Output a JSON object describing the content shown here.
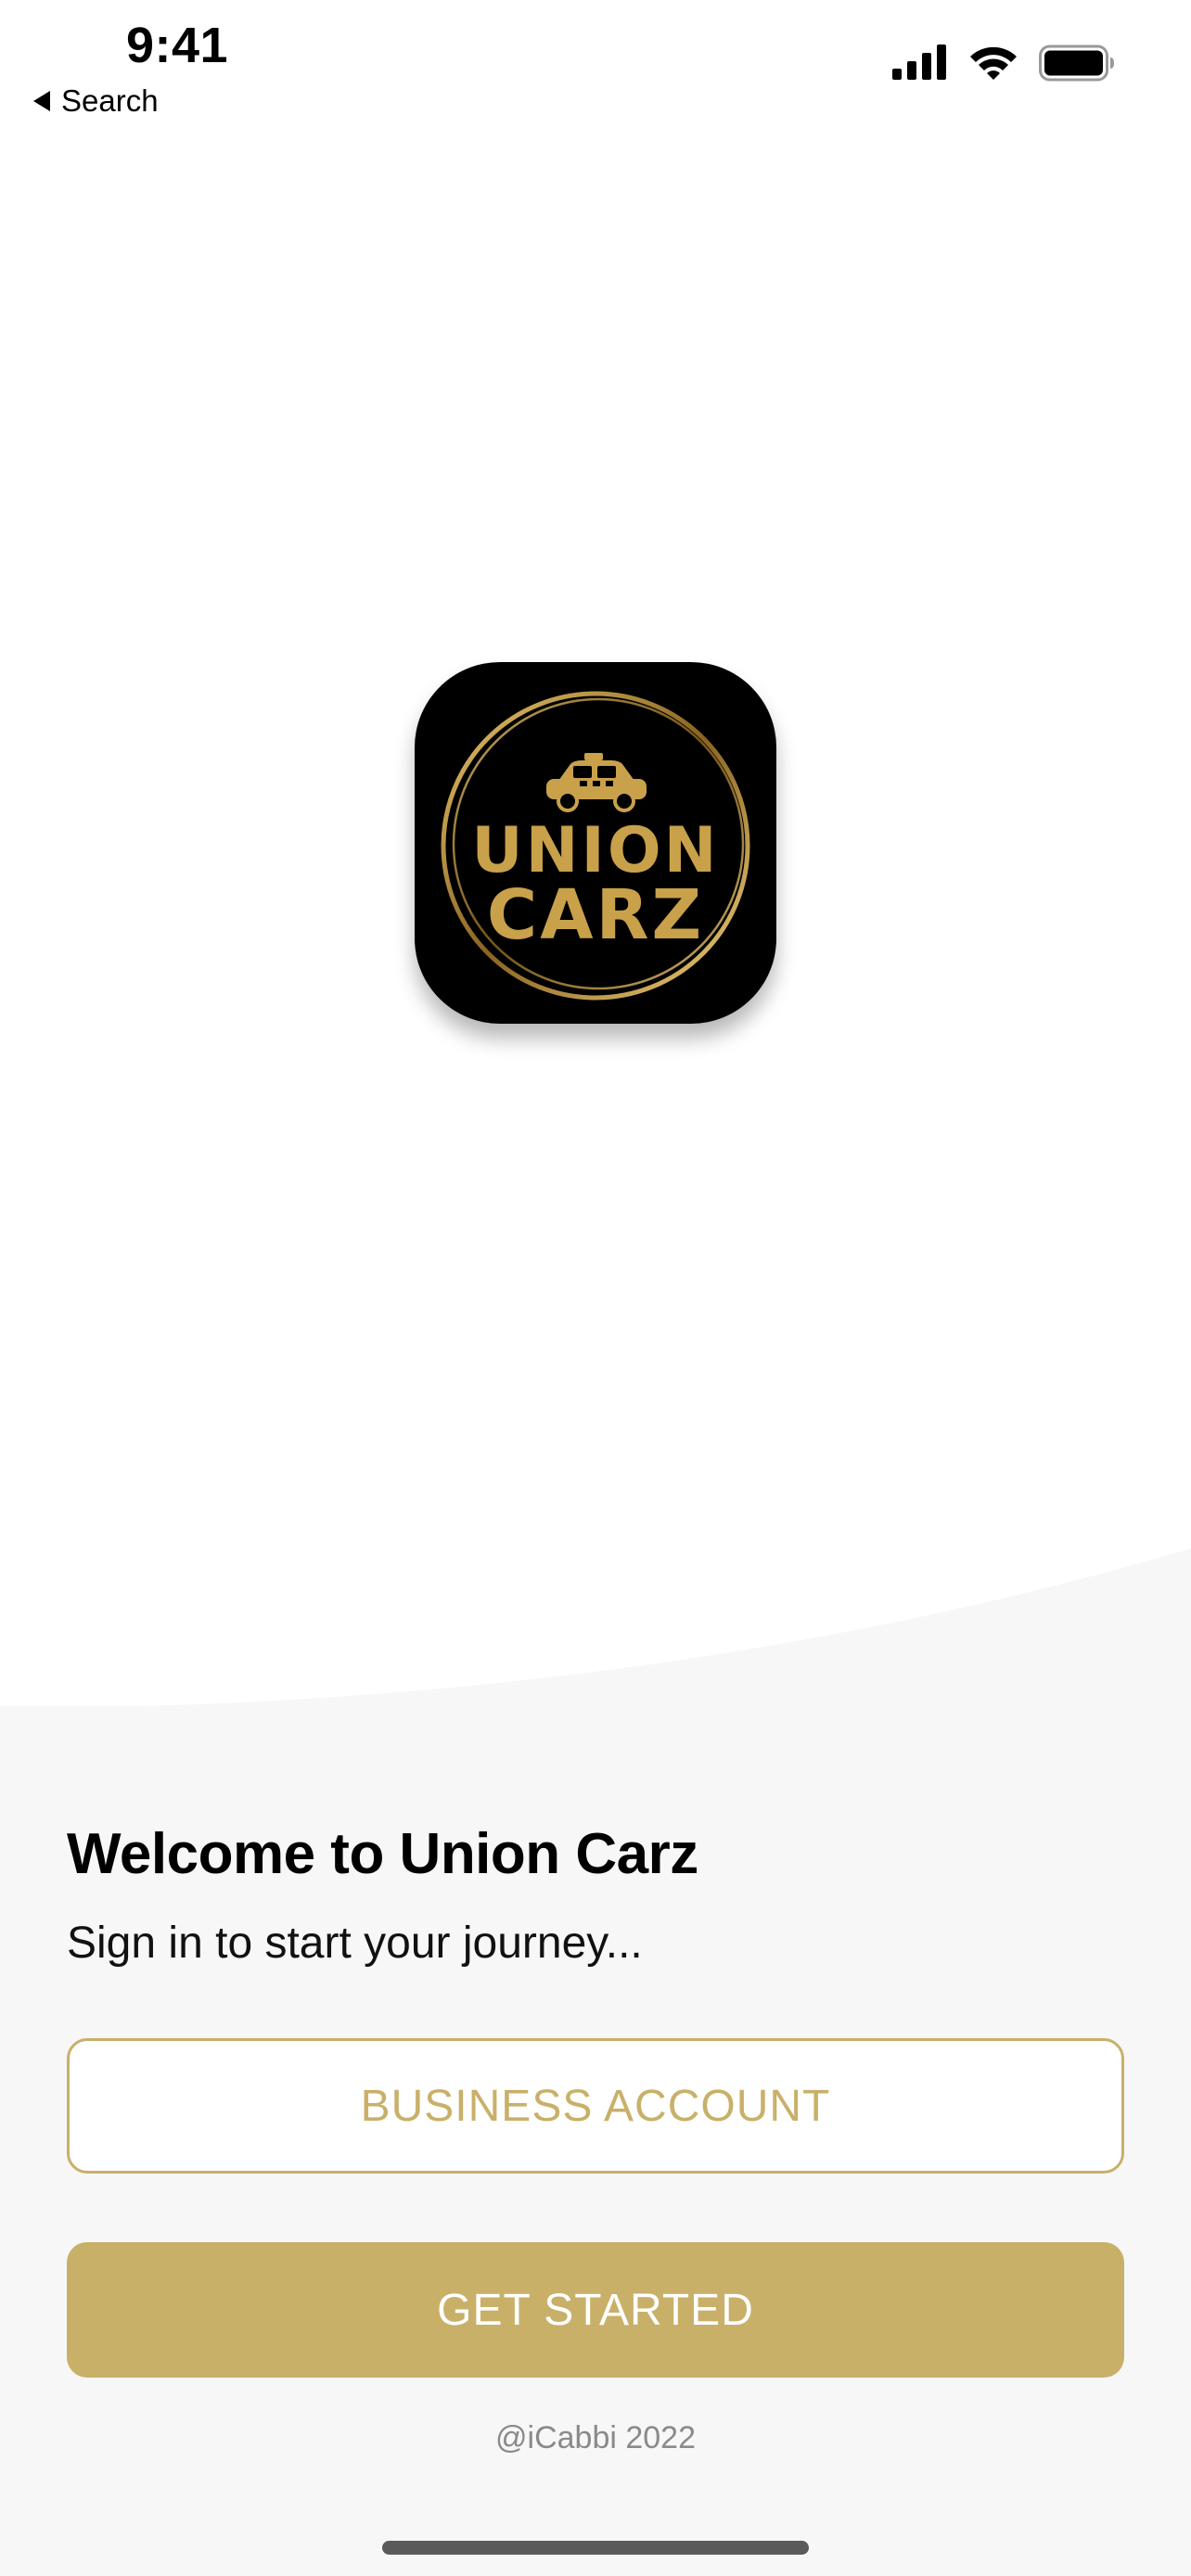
{
  "status_bar": {
    "time": "9:41",
    "back_label": "Search",
    "icons": [
      "cellular-signal-icon",
      "wifi-icon",
      "battery-icon"
    ]
  },
  "logo": {
    "line1": "UNION",
    "line2": "CARZ",
    "icon": "taxi-icon"
  },
  "welcome": {
    "title": "Welcome to Union Carz",
    "subtitle": "Sign in to start your journey..."
  },
  "buttons": {
    "business_account": "BUSINESS ACCOUNT",
    "get_started": "GET STARTED"
  },
  "footer": {
    "copyright": "@iCabbi 2022"
  },
  "colors": {
    "accent": "#c9b069",
    "logo_gold": "#c9a14a",
    "panel_background": "#f7f7f7"
  }
}
